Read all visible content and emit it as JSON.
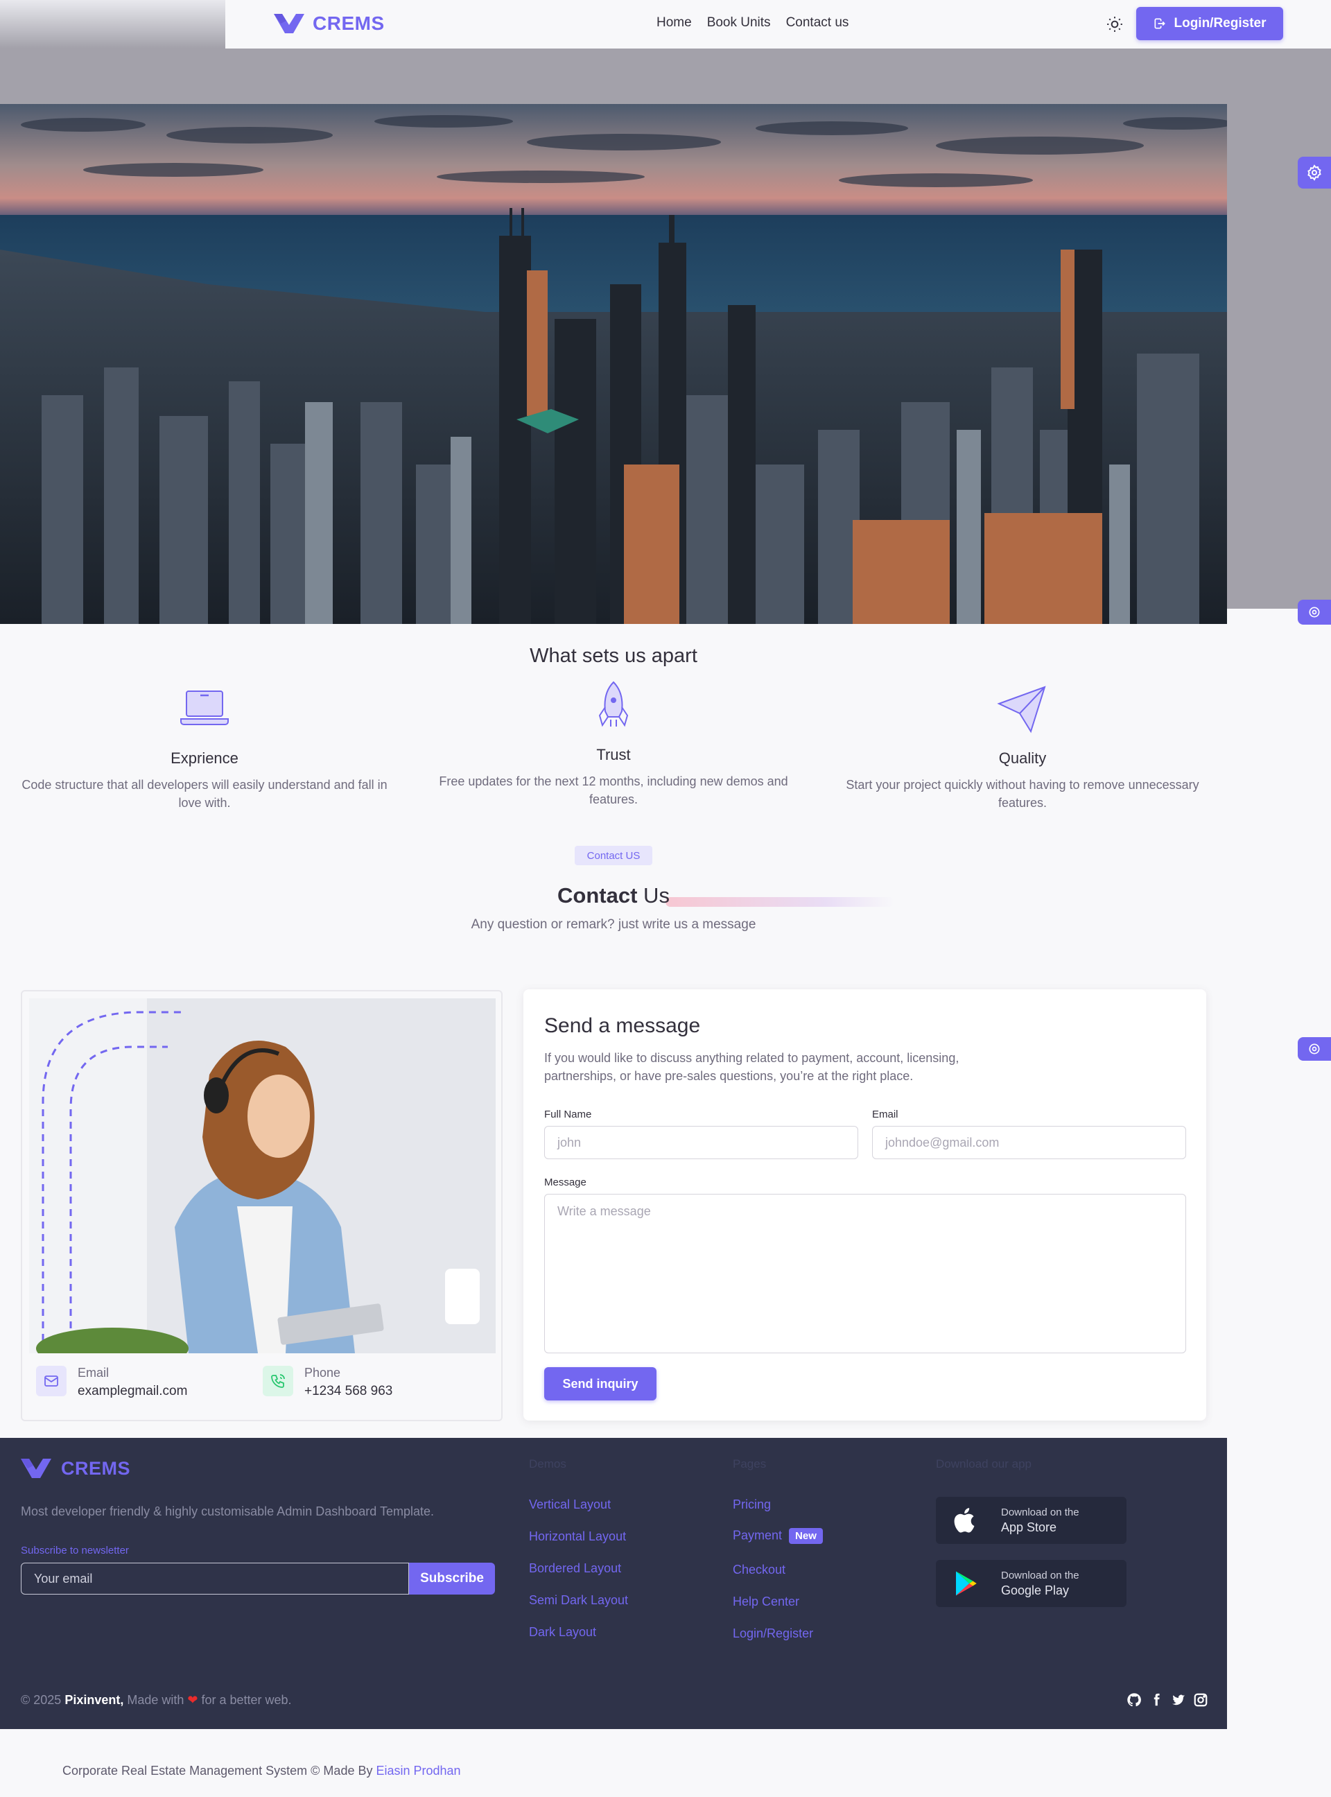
{
  "brand": {
    "name": "CREMS"
  },
  "nav": {
    "links": [
      "Home",
      "Book Units",
      "Contact us"
    ],
    "login_label": "Login/Register"
  },
  "features": {
    "title": "What sets us apart",
    "items": [
      {
        "title": "Exprience",
        "desc": "Code structure that all developers will easily understand and fall in love with.",
        "icon": "laptop-icon"
      },
      {
        "title": "Trust",
        "desc": "Free updates for the next 12 months, including new demos and features.",
        "icon": "rocket-icon"
      },
      {
        "title": "Quality",
        "desc": "Start your project quickly without having to remove unnecessary features.",
        "icon": "paper-plane-icon"
      }
    ]
  },
  "contact": {
    "badge": "Contact US",
    "title_bold": "Contact",
    "title_rest": " Us",
    "subtitle": "Any question or remark? just write us a message",
    "email_label": "Email",
    "email_value": "examplegmail.com",
    "phone_label": "Phone",
    "phone_value": "+1234 568 963"
  },
  "form": {
    "title": "Send a message",
    "desc": "If you would like to discuss anything related to payment, account, licensing, partnerships, or have pre-sales questions, you’re at the right place.",
    "full_name_label": "Full Name",
    "full_name_placeholder": "john",
    "email_label": "Email",
    "email_placeholder": "johndoe@gmail.com",
    "message_label": "Message",
    "message_placeholder": "Write a message",
    "submit_label": "Send inquiry"
  },
  "footer": {
    "brand": "CREMS",
    "tagline": "Most developer friendly & highly customisable Admin Dashboard Template.",
    "subscribe_label": "Subscribe to newsletter",
    "subscribe_placeholder": "Your email",
    "subscribe_button": "Subscribe",
    "demos_title": "Demos",
    "demos": [
      "Vertical Layout",
      "Horizontal Layout",
      "Bordered Layout",
      "Semi Dark Layout",
      "Dark Layout"
    ],
    "pages_title": "Pages",
    "pages": [
      "Pricing",
      "Payment",
      "Checkout",
      "Help Center",
      "Login/Register"
    ],
    "new_badge": "New",
    "app_title": "Download our app",
    "app_store_small": "Download on the",
    "app_store_big": "App Store",
    "play_small": "Download on the",
    "play_big": "Google Play",
    "copyright_prefix": "© 2025 ",
    "copyright_company": "Pixinvent,",
    "copyright_made": " Made with ",
    "copyright_suffix": " for a better web."
  },
  "page_footer": {
    "text": "Corporate Real Estate Management System © Made By ",
    "author": "Eiasin Prodhan"
  },
  "colors": {
    "primary": "#7367f0",
    "footer_bg": "#2f3349",
    "page_bg": "#f8f8fa"
  }
}
